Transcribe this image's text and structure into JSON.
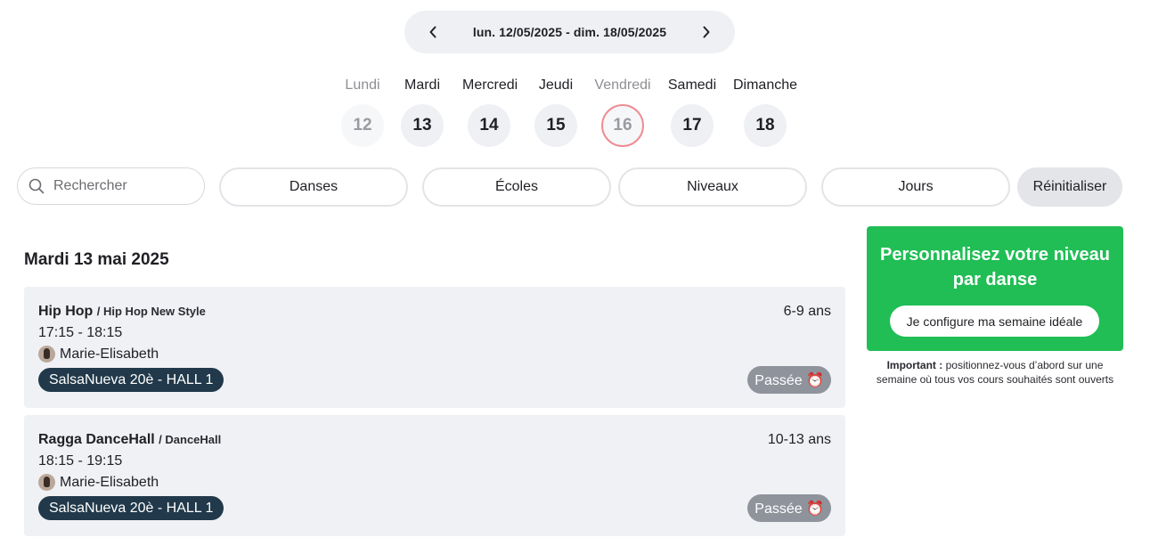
{
  "week": {
    "label": "lun. 12/05/2025 - dim. 18/05/2025"
  },
  "days": [
    {
      "name": "Lundi",
      "num": "12",
      "state": "past"
    },
    {
      "name": "Mardi",
      "num": "13",
      "state": "normal"
    },
    {
      "name": "Mercredi",
      "num": "14",
      "state": "normal"
    },
    {
      "name": "Jeudi",
      "num": "15",
      "state": "normal"
    },
    {
      "name": "Vendredi",
      "num": "16",
      "state": "today"
    },
    {
      "name": "Samedi",
      "num": "17",
      "state": "normal"
    },
    {
      "name": "Dimanche",
      "num": "18",
      "state": "normal"
    }
  ],
  "filters": {
    "search_placeholder": "Rechercher",
    "dances": "Danses",
    "schools": "Écoles",
    "levels": "Niveaux",
    "days": "Jours",
    "reset": "Réinitialiser"
  },
  "date_heading": "Mardi 13 mai 2025",
  "classes": [
    {
      "title": "Hip Hop",
      "style": "/ Hip Hop New Style",
      "time": "17:15 - 18:15",
      "teacher": "Marie-Elisabeth",
      "venue": "SalsaNueva 20è - HALL 1",
      "age": "6-9 ans",
      "status": "Passée ⏰"
    },
    {
      "title": "Ragga DanceHall",
      "style": "/ DanceHall",
      "time": "18:15 - 19:15",
      "teacher": "Marie-Elisabeth",
      "venue": "SalsaNueva 20è - HALL 1",
      "age": "10-13 ans",
      "status": "Passée ⏰"
    }
  ],
  "promo": {
    "title": "Personnalisez votre niveau par danse",
    "button": "Je configure ma semaine idéale",
    "note_bold": "Important :",
    "note_text": "positionnez-vous d’abord sur une semaine où tous vos cours souhaités sont ouverts"
  },
  "colors": {
    "promo_green": "#20be55",
    "venue_badge": "#21394a",
    "status_badge": "#8f939b",
    "today_ring": "#ee8c93"
  }
}
